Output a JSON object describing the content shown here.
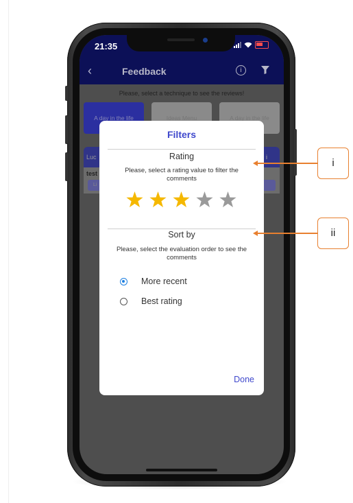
{
  "status_bar": {
    "time": "21:35"
  },
  "navbar": {
    "back_icon": "‹",
    "title": "Feedback",
    "info_icon": "i"
  },
  "background": {
    "hint": "Please, select a technique to see the reviews!",
    "cards": [
      "A day in the life",
      "Ideas Menu",
      "A day in the life"
    ],
    "review": {
      "author": "Luc",
      "text": "test",
      "right": "i",
      "strip": "Li"
    }
  },
  "modal": {
    "title": "Filters",
    "rating": {
      "heading": "Rating",
      "subtitle": "Please, select a rating value to filter the comments",
      "selected_stars": 3,
      "max_stars": 5
    },
    "sort": {
      "heading": "Sort by",
      "subtitle": "Please, select the evaluation order to see the comments",
      "options": [
        {
          "label": "More recent",
          "checked": true
        },
        {
          "label": "Best rating",
          "checked": false
        }
      ]
    },
    "done_label": "Done"
  },
  "callouts": {
    "first": "i",
    "second": "ii"
  },
  "colors": {
    "navbar": "#0c1057",
    "accent": "#3f48cc",
    "star_active": "#f5b800",
    "star_inactive": "#9a9a9a",
    "radio_selected": "#1e7fe0",
    "callout": "#e8802f"
  }
}
